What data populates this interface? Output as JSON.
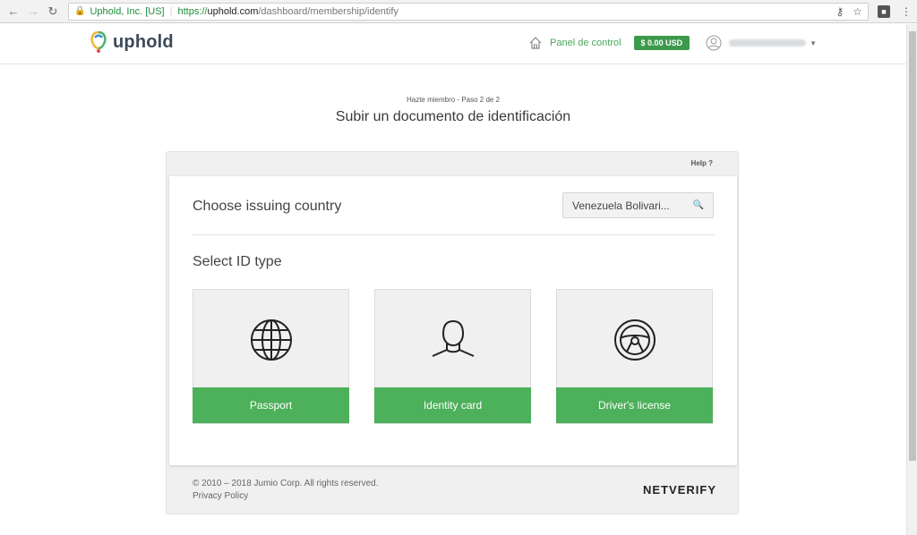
{
  "browser": {
    "secure_label": "Uphold, Inc. [US]",
    "url_scheme": "https://",
    "url_host": "uphold.com",
    "url_path": "/dashboard/membership/identify"
  },
  "header": {
    "logo_text": "uphold",
    "panel_link": "Panel de control",
    "balance": "$ 0.00 USD"
  },
  "page": {
    "step": "Hazte miembro - Paso 2 de 2",
    "title": "Subir un documento de identificación"
  },
  "card": {
    "help": "Help ?",
    "country_label": "Choose issuing country",
    "country_value": "Venezuela Bolivari...",
    "id_type_label": "Select ID type",
    "tiles": [
      {
        "label": "Passport",
        "icon": "globe-icon"
      },
      {
        "label": "Identity card",
        "icon": "person-icon"
      },
      {
        "label": "Driver's license",
        "icon": "steering-wheel-icon"
      }
    ],
    "copyright": "© 2010 – 2018 Jumio Corp. All rights reserved.",
    "privacy": "Privacy Policy",
    "brand": "NETVERIFY"
  },
  "colors": {
    "accent_green": "#4db05a",
    "balance_green": "#3d9a4c"
  }
}
